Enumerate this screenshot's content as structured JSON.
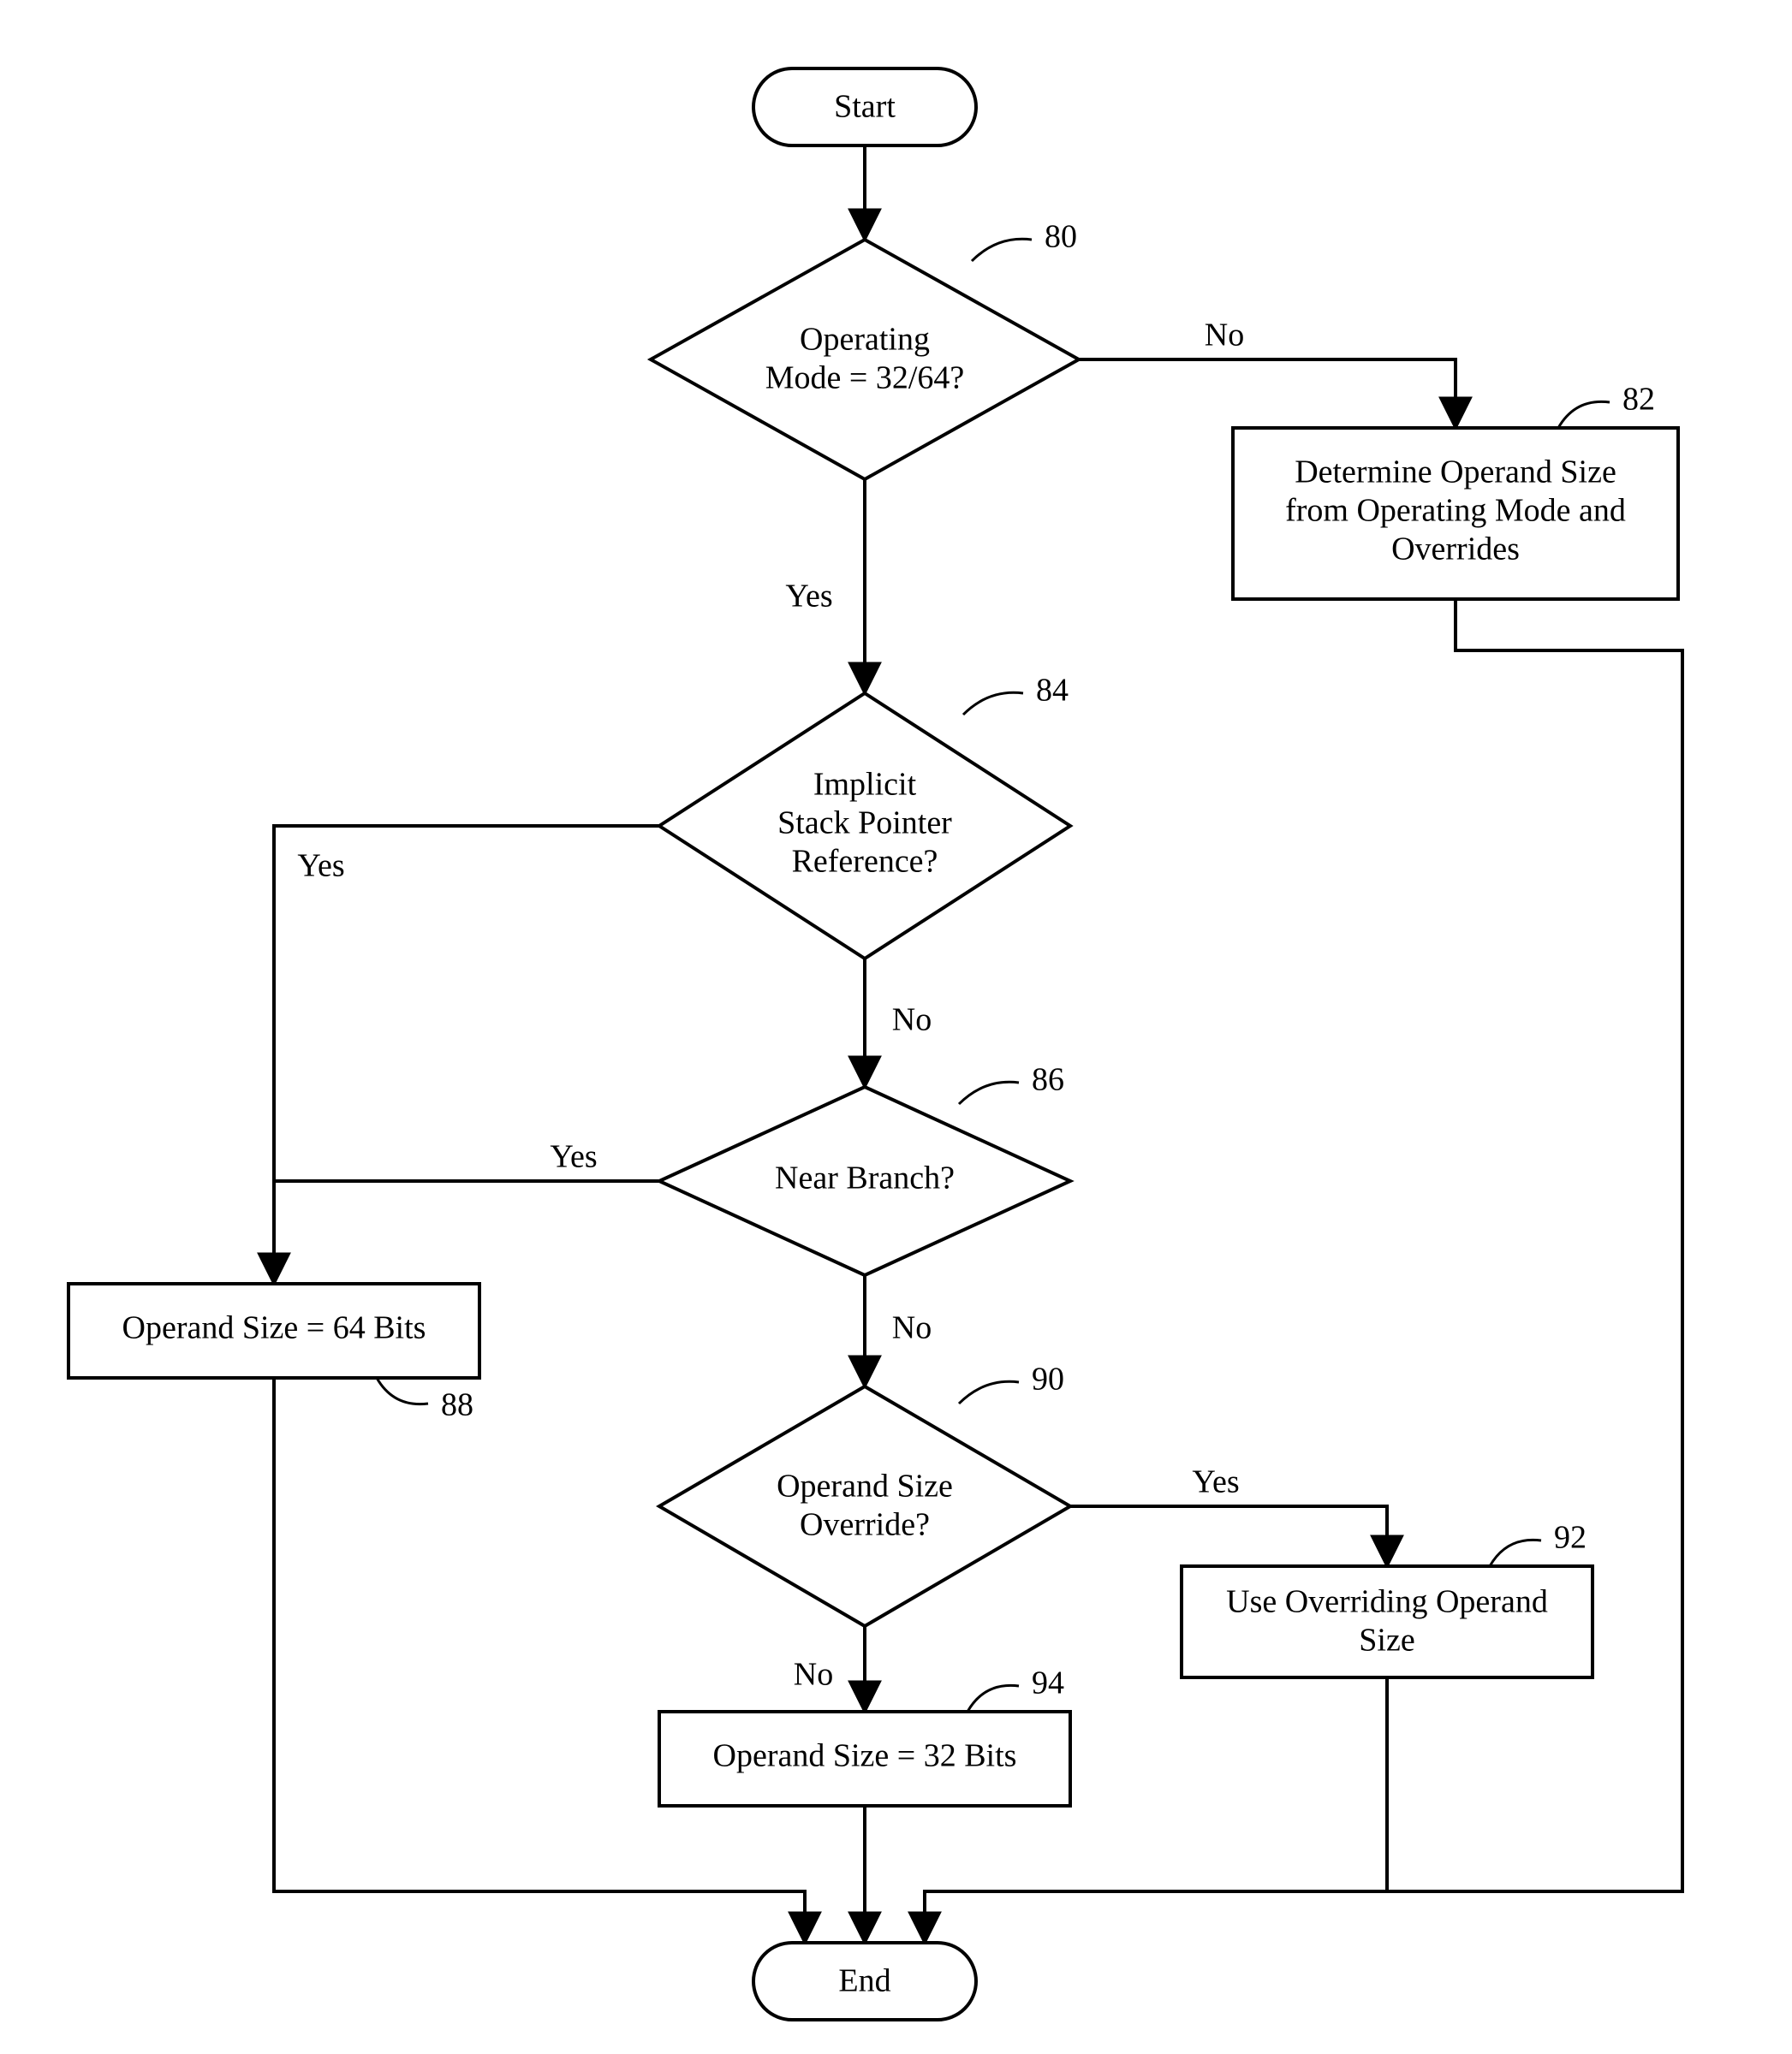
{
  "nodes": {
    "start": {
      "text": "Start"
    },
    "end": {
      "text": "End"
    },
    "d80": {
      "ref": "80",
      "line1": "Operating",
      "line2": "Mode = 32/64?"
    },
    "d84": {
      "ref": "84",
      "line1": "Implicit",
      "line2": "Stack Pointer",
      "line3": "Reference?"
    },
    "d86": {
      "ref": "86",
      "line1": "Near Branch?"
    },
    "d90": {
      "ref": "90",
      "line1": "Operand Size",
      "line2": "Override?"
    },
    "p82": {
      "ref": "82",
      "line1": "Determine Operand Size",
      "line2": "from Operating Mode and",
      "line3": "Overrides"
    },
    "p88": {
      "ref": "88",
      "line1": "Operand Size = 64 Bits"
    },
    "p92": {
      "ref": "92",
      "line1": "Use Overriding Operand",
      "line2": "Size"
    },
    "p94": {
      "ref": "94",
      "line1": "Operand Size = 32 Bits"
    }
  },
  "edges": {
    "yes": "Yes",
    "no": "No"
  },
  "chart_data": {
    "type": "flowchart",
    "nodes": [
      {
        "id": "start",
        "kind": "terminator",
        "label": "Start"
      },
      {
        "id": "d80",
        "kind": "decision",
        "ref": "80",
        "label": "Operating Mode = 32/64?"
      },
      {
        "id": "p82",
        "kind": "process",
        "ref": "82",
        "label": "Determine Operand Size from Operating Mode and Overrides"
      },
      {
        "id": "d84",
        "kind": "decision",
        "ref": "84",
        "label": "Implicit Stack Pointer Reference?"
      },
      {
        "id": "d86",
        "kind": "decision",
        "ref": "86",
        "label": "Near Branch?"
      },
      {
        "id": "p88",
        "kind": "process",
        "ref": "88",
        "label": "Operand Size = 64 Bits"
      },
      {
        "id": "d90",
        "kind": "decision",
        "ref": "90",
        "label": "Operand Size Override?"
      },
      {
        "id": "p92",
        "kind": "process",
        "ref": "92",
        "label": "Use Overriding Operand Size"
      },
      {
        "id": "p94",
        "kind": "process",
        "ref": "94",
        "label": "Operand Size = 32 Bits"
      },
      {
        "id": "end",
        "kind": "terminator",
        "label": "End"
      }
    ],
    "edges": [
      {
        "from": "start",
        "to": "d80"
      },
      {
        "from": "d80",
        "to": "d84",
        "label": "Yes"
      },
      {
        "from": "d80",
        "to": "p82",
        "label": "No"
      },
      {
        "from": "p82",
        "to": "end"
      },
      {
        "from": "d84",
        "to": "p88",
        "label": "Yes"
      },
      {
        "from": "d84",
        "to": "d86",
        "label": "No"
      },
      {
        "from": "d86",
        "to": "p88",
        "label": "Yes"
      },
      {
        "from": "d86",
        "to": "d90",
        "label": "No"
      },
      {
        "from": "p88",
        "to": "end"
      },
      {
        "from": "d90",
        "to": "p92",
        "label": "Yes"
      },
      {
        "from": "d90",
        "to": "p94",
        "label": "No"
      },
      {
        "from": "p92",
        "to": "end"
      },
      {
        "from": "p94",
        "to": "end"
      }
    ]
  }
}
